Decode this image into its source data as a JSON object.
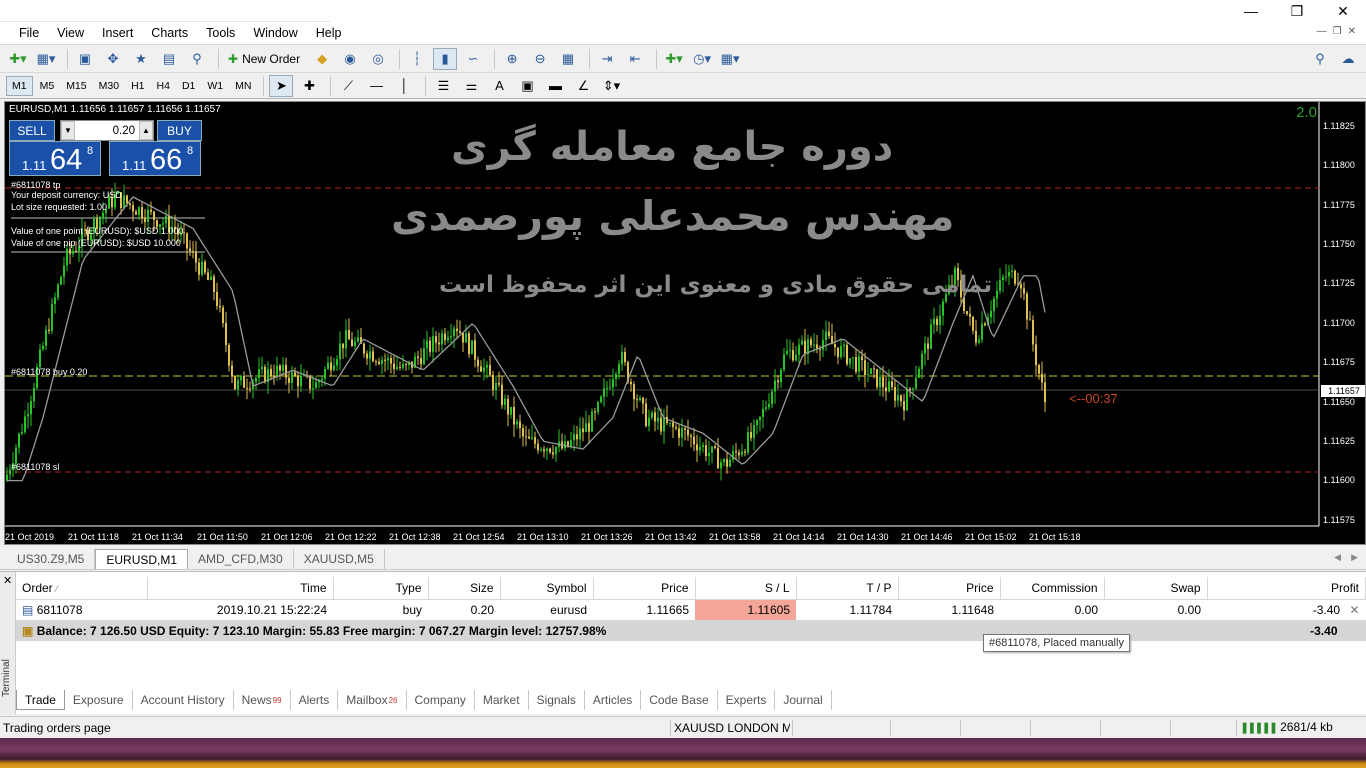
{
  "menu": [
    "File",
    "View",
    "Insert",
    "Charts",
    "Tools",
    "Window",
    "Help"
  ],
  "toolbar": {
    "new_order": "New Order"
  },
  "timeframes": [
    "M1",
    "M5",
    "M15",
    "M30",
    "H1",
    "H4",
    "D1",
    "W1",
    "MN"
  ],
  "active_timeframe": "M1",
  "chart": {
    "header": "EURUSD,M1  1.11656 1.11657 1.11656 1.11657",
    "scale_value": "2.0",
    "one_click": {
      "sell": "SELL",
      "buy": "BUY",
      "volume": "0.20",
      "bid_prefix": "1.11",
      "bid_big": "64",
      "bid_sup": "8",
      "ask_prefix": "1.11",
      "ask_big": "66",
      "ask_sup": "8"
    },
    "info_lines": [
      "#6811078 tp",
      "Your deposit currency: USD",
      "Lot size requested: 1.00",
      "Value of one point (EURUSD): $USD 1.000",
      "Value of one pip (EURUSD): $USD 10.000"
    ],
    "order_labels": {
      "buy": "#6811078 buy 0.20",
      "sl": "#6811078 sl"
    },
    "watermark": {
      "line1": "دوره جامع معامله گری",
      "line2": "مهندس محمدعلی پورصمدی",
      "line3": "تمامی حقوق مادی و معنوی این اثر محفوظ است"
    },
    "countdown": "<--00:37",
    "current_price_tag": "1.11657",
    "price_levels": [
      "1.11825",
      "1.11800",
      "1.11775",
      "1.11750",
      "1.11725",
      "1.11700",
      "1.11675",
      "1.11650",
      "1.11625",
      "1.11600",
      "1.11575"
    ],
    "time_labels": [
      "21 Oct 2019",
      "21 Oct 11:18",
      "21 Oct 11:34",
      "21 Oct 11:50",
      "21 Oct 12:06",
      "21 Oct 12:22",
      "21 Oct 12:38",
      "21 Oct 12:54",
      "21 Oct 13:10",
      "21 Oct 13:26",
      "21 Oct 13:42",
      "21 Oct 13:58",
      "21 Oct 14:14",
      "21 Oct 14:30",
      "21 Oct 14:46",
      "21 Oct 15:02",
      "21 Oct 15:18"
    ],
    "colors": {
      "bull": "#27c427",
      "bear": "#e0c050",
      "ma": "#9a9a9a",
      "tp_sl": "#b22222",
      "entry": "#c8c83a"
    }
  },
  "chart_tabs": [
    "US30.Z9,M5",
    "EURUSD,M1",
    "AMD_CFD,M30",
    "XAUUSD,M5"
  ],
  "active_chart_tab": "EURUSD,M1",
  "trade_table": {
    "headers": [
      "Order",
      "Time",
      "Type",
      "Size",
      "Symbol",
      "Price",
      "S / L",
      "T / P",
      "Price",
      "Commission",
      "Swap",
      "Profit"
    ],
    "row": [
      "6811078",
      "2019.10.21 15:22:24",
      "buy",
      "0.20",
      "eurusd",
      "1.11665",
      "1.11605",
      "1.11784",
      "1.11648",
      "0.00",
      "0.00",
      "-3.40"
    ],
    "balance": "Balance: 7 126.50 USD  Equity: 7 123.10  Margin: 55.83  Free margin: 7 067.27  Margin level: 12757.98%",
    "total_profit": "-3.40"
  },
  "tooltip": "#6811078, Placed manually",
  "terminal_label": "Terminal",
  "terminal_tabs": [
    {
      "label": "Trade",
      "badge": ""
    },
    {
      "label": "Exposure",
      "badge": ""
    },
    {
      "label": "Account History",
      "badge": ""
    },
    {
      "label": "News",
      "badge": "99"
    },
    {
      "label": "Alerts",
      "badge": ""
    },
    {
      "label": "Mailbox",
      "badge": "26"
    },
    {
      "label": "Company",
      "badge": ""
    },
    {
      "label": "Market",
      "badge": ""
    },
    {
      "label": "Signals",
      "badge": ""
    },
    {
      "label": "Articles",
      "badge": ""
    },
    {
      "label": "Code Base",
      "badge": ""
    },
    {
      "label": "Experts",
      "badge": ""
    },
    {
      "label": "Journal",
      "badge": ""
    }
  ],
  "status": {
    "left": "Trading orders page",
    "middle": "XAUUSD LONDON M",
    "traffic": "2681/4 kb"
  }
}
